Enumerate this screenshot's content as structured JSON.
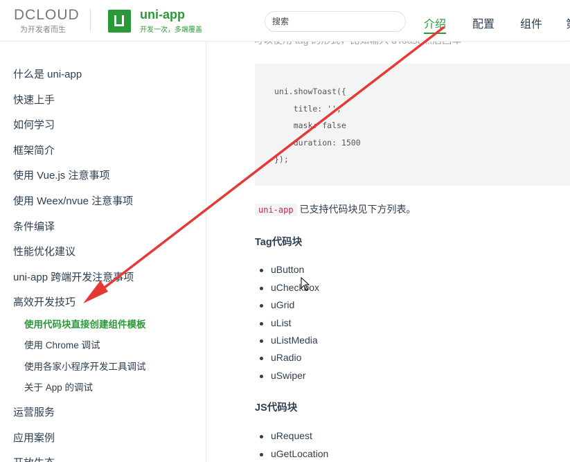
{
  "header": {
    "dcloud_logo": "DCLOUD",
    "dcloud_slogan": "为开发者而生",
    "uniapp_name": "uni-app",
    "uniapp_slogan": "开发一次，多端覆盖",
    "search_placeholder": "搜索",
    "nav": [
      "介绍",
      "配置",
      "组件",
      "第"
    ],
    "brand_color": "#2b9939"
  },
  "sidebar": {
    "items": [
      "什么是 uni-app",
      "快速上手",
      "如何学习",
      "框架简介",
      "使用 Vue.js 注意事项",
      "使用 Weex/nvue 注意事项",
      "条件编译",
      "性能优化建议",
      "uni-app 跨端开发注意事项",
      "高效开发技巧"
    ],
    "sub_items": [
      "使用代码块直接创建组件模板",
      "使用 Chrome 调试",
      "使用各家小程序开发工具调试",
      "关于 App 的调试"
    ],
    "items_after": [
      "运营服务",
      "应用案例",
      "开放生态"
    ]
  },
  "content": {
    "cut_line": "可以使用 tag 的形式，比如输入 uToast 然后回车",
    "code_lines": [
      "uni.showToast({",
      "    title: '',",
      "    mask: false",
      "    duration: 1500",
      "});"
    ],
    "intro_code": "uni-app",
    "intro_text": "已支持代码块见下方列表。",
    "tag_heading": "Tag代码块",
    "tag_items": [
      "uButton",
      "uCheckbox",
      "uGrid",
      "uList",
      "uListMedia",
      "uRadio",
      "uSwiper"
    ],
    "js_heading": "JS代码块",
    "js_items": [
      "uRequest",
      "uGetLocation"
    ]
  },
  "annotation": {
    "arrow_color": "#e53935",
    "arrow_from": "nav-介绍",
    "arrow_to": "sidebar-高效开发技巧"
  }
}
